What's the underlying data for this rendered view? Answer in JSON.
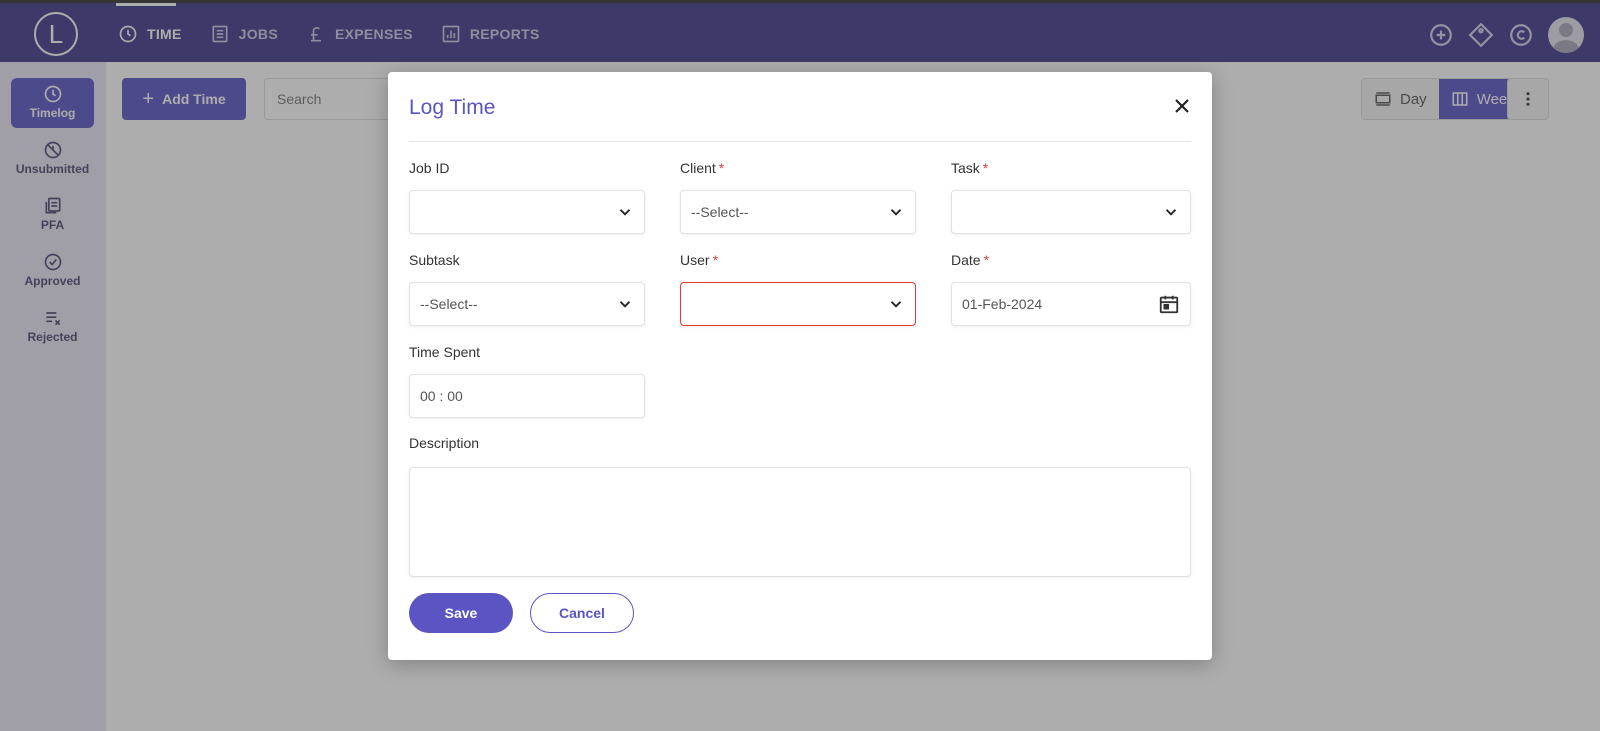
{
  "app": {
    "logo_letter": "L"
  },
  "topnav": {
    "items": [
      {
        "label": "TIME",
        "icon": "clock-icon"
      },
      {
        "label": "JOBS",
        "icon": "list-icon"
      },
      {
        "label": "EXPENSES",
        "icon": "pound-icon"
      },
      {
        "label": "REPORTS",
        "icon": "bar-chart-icon"
      }
    ],
    "right_icons": [
      "add-circle-icon",
      "tag-icon",
      "copyright-icon",
      "user-avatar-icon"
    ]
  },
  "sidebar": {
    "items": [
      {
        "label": "Timelog",
        "icon": "clock-icon"
      },
      {
        "label": "Unsubmitted",
        "icon": "unsubmitted-icon"
      },
      {
        "label": "PFA",
        "icon": "documents-icon"
      },
      {
        "label": "Approved",
        "icon": "check-circle-icon"
      },
      {
        "label": "Rejected",
        "icon": "list-x-icon"
      }
    ]
  },
  "toolbar": {
    "add_time_label": "Add Time",
    "search_placeholder": "Search",
    "day_label": "Day",
    "week_label": "Week"
  },
  "modal": {
    "title": "Log Time",
    "fields": {
      "job_id": {
        "label": "Job ID",
        "value": ""
      },
      "client": {
        "label": "Client",
        "value": "--Select--"
      },
      "task": {
        "label": "Task",
        "value": ""
      },
      "subtask": {
        "label": "Subtask",
        "value": "--Select--"
      },
      "user": {
        "label": "User",
        "value": ""
      },
      "date": {
        "label": "Date",
        "value": "01-Feb-2024"
      },
      "time_spent": {
        "label": "Time Spent",
        "value": "00 : 00"
      },
      "description": {
        "label": "Description",
        "value": ""
      }
    },
    "required_marker": "*",
    "save_label": "Save",
    "cancel_label": "Cancel"
  },
  "colors": {
    "brand": "#3f3a8a",
    "accent": "#5b55c4",
    "error": "#e23a3a"
  }
}
